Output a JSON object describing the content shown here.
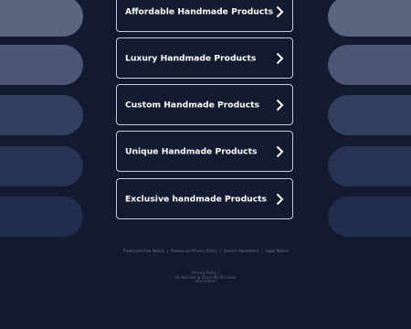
{
  "links": [
    {
      "label": "Affordable Handmade Products"
    },
    {
      "label": "Luxury Handmade Products"
    },
    {
      "label": "Custom Handmade Products"
    },
    {
      "label": "Unique Handmade Products"
    },
    {
      "label": "Exclusive handmade Products"
    }
  ],
  "footer": {
    "links": [
      "Trademark Free Notice",
      "Review our Privacy Policy",
      "Service Agreement",
      "Legal Notice"
    ],
    "privacy_policy": "Privacy Policy",
    "do_not_sell_line1": "Do Not Sell or Share My Personal",
    "do_not_sell_line2": "Information"
  },
  "colors": {
    "background": "#131a2f",
    "box_border": "#c5cad6",
    "text": "#ffffff"
  },
  "icons": {
    "link_arrow": "chevron-right-icon"
  }
}
